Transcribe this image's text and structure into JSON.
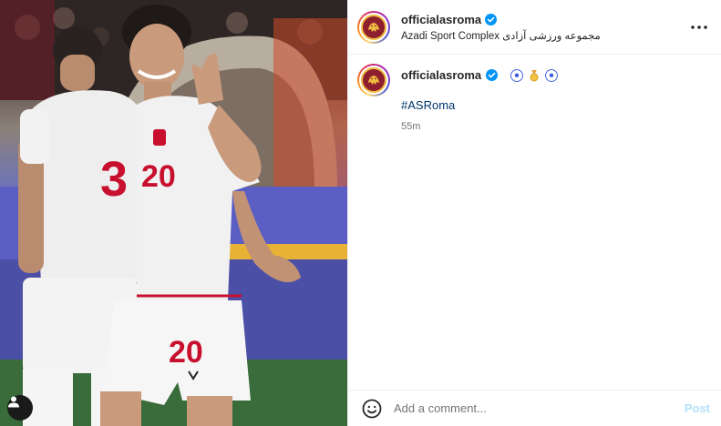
{
  "post": {
    "username": "officialasroma",
    "verified": true,
    "location": "Azadi Sport Complex مجموعه ورزشی آزادی",
    "caption_emojis": [
      "soccer-ball-icon",
      "medal-icon",
      "soccer-ball-icon"
    ],
    "hashtag": "#ASRoma",
    "timestamp": "55m"
  },
  "photo": {
    "jersey_numbers": {
      "back_player": "3",
      "front_player": "20",
      "shorts": "20"
    }
  },
  "comment_bar": {
    "placeholder": "Add a comment...",
    "post_label": "Post"
  },
  "colors": {
    "verified_blue": "#0095f6",
    "hashtag_blue": "#00376b",
    "post_button_disabled": "#b2dffc",
    "jersey_red": "#c8102e"
  }
}
